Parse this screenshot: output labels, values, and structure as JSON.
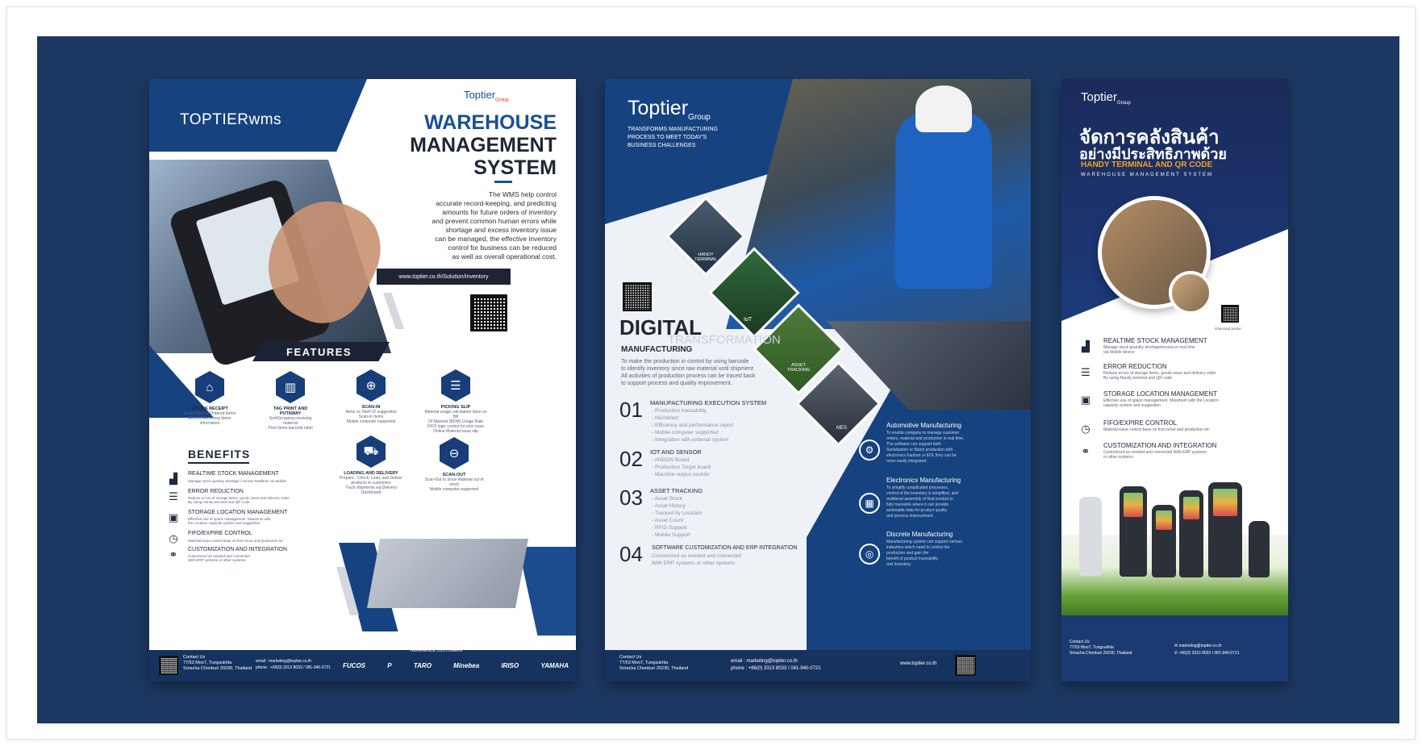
{
  "poster1": {
    "brand": "TOPTIERwms",
    "corner_logo": "Toptier",
    "corner_logo_sub": "Group",
    "title_lines": [
      "WAREHOUSE",
      "MANAGEMENT",
      "SYSTEM"
    ],
    "description": [
      "The WMS help control",
      "accurate record-keeping, and predicting",
      "amounts for future orders of inventory",
      "and prevent common human errors while",
      "shortage and excess inventory issue",
      "can be managed, the effective inventory",
      "control for business can be reduced",
      "as well as overall operational cost."
    ],
    "url": "www.toptier.co.th/Solution/Inventory",
    "features_heading": "FEATURES",
    "features": [
      {
        "icon": "basket-icon",
        "title": "GOODS RECEIPT",
        "desc": [
          "Keep Track of Ordered Items",
          "Record Receiving Items information"
        ]
      },
      {
        "icon": "barcode-icon",
        "title": "TAG PRINT AND PUTAWAY",
        "desc": [
          "Sort/Grouping receiving material",
          "Print Items barcode label"
        ]
      },
      {
        "icon": "plus-circle-icon",
        "title": "SCAN-IN",
        "desc": [
          "Items vs Shelf ID suggestion",
          "Scan-In Items",
          "Mobile computer supported"
        ]
      },
      {
        "icon": "document-icon",
        "title": "PICKING SLIP",
        "desc": [
          "Material usage calculation base on Bill",
          "Of Material (BOM) Usage Rate",
          "FIFO logic control for pick issue",
          "Online Material issue slip"
        ]
      },
      {
        "icon": "truck-icon",
        "title": "LOADING AND DELIVERY",
        "desc": [
          "Prepare , Check, Load, and Deliver",
          "products to customers",
          "Track shipments via Delivery Dashboard"
        ]
      },
      {
        "icon": "minus-circle-icon",
        "title": "SCAN-OUT",
        "desc": [
          "Scan-Out to Issue Material out of stock",
          "Mobile computer supported"
        ]
      }
    ],
    "benefits_heading": "BENEFITS",
    "benefits": [
      {
        "icon": "bar-chart-icon",
        "title": "REALTIME STOCK MANAGEMENT",
        "desc": [
          "Manage stock quantity shortage / excess Realtime via Mobile"
        ]
      },
      {
        "icon": "list-icon",
        "title": "ERROR REDUCTION",
        "desc": [
          "Reduce errors of storage items, goods issue and delivery order",
          "By using Handy terminal and QR code"
        ]
      },
      {
        "icon": "box-icon",
        "title": "STORAGE LOCATION MANAGEMENT",
        "desc": [
          "Effective use of space management. Maximum with",
          "the Location capacity system and suggestion"
        ]
      },
      {
        "icon": "clock-icon",
        "title": "FIFO/EXPIRE CONTROL",
        "desc": [
          "Material issue control base on first in/out and production lot"
        ]
      },
      {
        "icon": "link-icon",
        "title": "CUSTOMIZATION AND INTEGRATION",
        "desc": [
          "Customized as needed and connected",
          "With ERP systems or other systems"
        ]
      }
    ],
    "footer": {
      "contact_title": "Contact Us",
      "address": [
        "77/53 Moo7, Tungsukhla",
        "Sriracha Chonburi 20230, Thailand"
      ],
      "email_label": "email",
      "email": "marketing@toptier.co.th",
      "phone_label": "phone",
      "phone": "+66(0) 3313 8033 / 081-940-0721",
      "customers_title": "REFERENCE CUSTOMERS",
      "customers": [
        "FUCOS",
        "P",
        "TARO",
        "Minebea",
        "IRISO",
        "YAMAHA"
      ]
    }
  },
  "poster2": {
    "logo": "Toptier",
    "logo_sub": "Group",
    "tagline": [
      "TRANSFORMS MANUFACTURING",
      "PROCESS TO MEET TODAY'S",
      "BUSINESS CHALLENGES"
    ],
    "tiles": [
      "HANDY TERMINAL",
      "IoT",
      "ASSET TRACKING",
      "MES"
    ],
    "heading": "DIGITAL",
    "heading_ghost": "TRANSFORMATION",
    "heading_sub": "MANUFACTURING",
    "intro": [
      "To make the production in control by using barcode",
      "to identify inventory since raw material until shipment",
      "All activities of production process can be traced back",
      "to support process and quality improvement."
    ],
    "items": [
      {
        "num": "01",
        "title": "MANUFACTURING EXECUTION SYSTEM",
        "points": [
          "- Production traceability",
          "- NG/defect",
          "- Efficiency and performance report",
          "- Mobile computer supported",
          "- Integration with external system"
        ]
      },
      {
        "num": "02",
        "title": "IOT AND SENSOR",
        "points": [
          "- ANDON Board",
          "- Production Target board",
          "- Machine output counter"
        ]
      },
      {
        "num": "03",
        "title": "ASSET TRACKING",
        "points": [
          "- Asset Stock",
          "- Asset History",
          "- Tracked by Location",
          "- Asset Count",
          "- RFID Support",
          "- Mobile Support"
        ]
      },
      {
        "num": "04",
        "title": "SOFTWARE CUSTOMIZATION AND ERP INTEGRATION",
        "points": [
          "Customized as needed and connected",
          "With ERP systems or other systems"
        ]
      }
    ],
    "industries": [
      {
        "icon": "gear-icon",
        "title": "Automotive Manufacturing",
        "desc": [
          "To enable company to manage customer",
          "orders, material and production in real time.",
          "The software can support both",
          "Serialization or Batch production with",
          "electronics Kanban or EDI, they can be",
          "more easily integrated."
        ]
      },
      {
        "icon": "chip-icon",
        "title": "Electronics Manufacturing",
        "desc": [
          "To simplify complicated processes,",
          "control of the inventory is simplified, and",
          "multilevel assembly of final product is",
          "fully traceable where it can provide",
          "actionable data for product quality",
          "and process improvement."
        ]
      },
      {
        "icon": "target-icon",
        "title": "Discrete Manufacturing",
        "desc": [
          "Manufacturing system can support various",
          "industries which need to control the",
          "production and gain the",
          "benefit of product traceability",
          "and inventory."
        ]
      }
    ],
    "footer": {
      "contact_title": "Contact Us",
      "address": [
        "77/53 Moo7, Tungsukhla",
        "Sriracha Chonburi 20230, Thailand"
      ],
      "email_label": "email",
      "email": "marketing@toptier.co.th",
      "phone_label": "phone",
      "phone": "+66(0) 3313 8033 / 081-940-0721",
      "website": "www.toptier.co.th"
    }
  },
  "poster3": {
    "logo": "Toptier",
    "logo_sub": "Group",
    "thai_line1": "จัดการคลังสินค้า",
    "thai_line2": "อย่างมีประสิทธิภาพด้วย",
    "subtitle": "HANDY TERMINAL AND QR CODE",
    "subtitle2": "WAREHOUSE MANAGEMENT SYSTEM",
    "download_label": "download poster",
    "benefits": [
      {
        "icon": "bar-chart-icon",
        "title": "REALTIME STOCK MANAGEMENT",
        "desc": [
          "Manage stock quantity shortage/excess in real time",
          "via Mobile device"
        ]
      },
      {
        "icon": "list-icon",
        "title": "ERROR REDUCTION",
        "desc": [
          "Reduce errors of storage items, goods issue and delivery order",
          "By using Handy terminal and QR code"
        ]
      },
      {
        "icon": "box-icon",
        "title": "STORAGE LOCATION MANAGEMENT",
        "desc": [
          "Effective use of space management. Maximum with the Location",
          "capacity system and suggestion"
        ]
      },
      {
        "icon": "clock-icon",
        "title": "FIFO/EXPIRE CONTROL",
        "desc": [
          "Material issue control base on first in/out and production lot"
        ]
      },
      {
        "icon": "link-icon",
        "title": "CUSTOMIZATION AND INTEGRATION",
        "desc": [
          "Customized as needed and connected With ERP systems",
          "or other systems"
        ]
      }
    ],
    "footer": {
      "contact_title": "Contact Us",
      "address": [
        "77/53 Moo7, Tungsukhla",
        "Sriracha Chonburi 20230, Thailand"
      ],
      "email": "marketing@toptier.co.th",
      "phone": "+66(0) 3313 8033 / 081-940-0721"
    }
  },
  "colors": {
    "stage": "#1c3761",
    "navy": "#173766",
    "accent_orange": "#f0a21f",
    "band_blue": "#16437f"
  }
}
